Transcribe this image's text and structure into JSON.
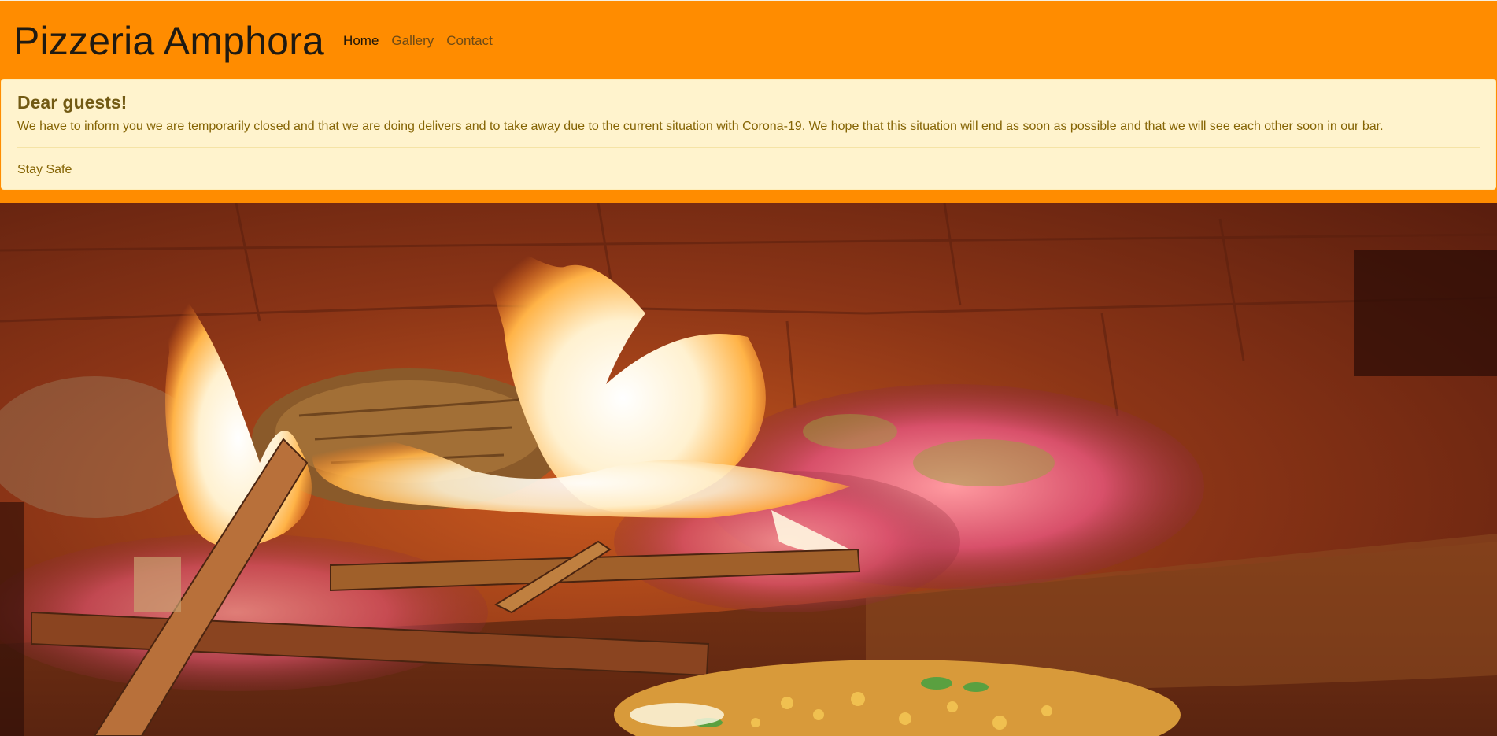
{
  "navbar": {
    "brand": "Pizzeria Amphora",
    "links": [
      {
        "label": "Home",
        "active": true
      },
      {
        "label": "Gallery",
        "active": false
      },
      {
        "label": "Contact",
        "active": false
      }
    ]
  },
  "alert": {
    "heading": "Dear guests!",
    "message": "We have to inform you we are temporarily closed and that we are doing delivers and to take away due to the current situation with Corona-19. We hope that this situation will end as soon as possible and that we will see each other soon in our bar.",
    "footer": "Stay Safe"
  },
  "hero": {
    "image": "wood-fired-oven-flames-photo"
  },
  "colors": {
    "navbar_bg": "#ff8c00",
    "alert_bg": "#fff3cd",
    "alert_text": "#856404"
  }
}
